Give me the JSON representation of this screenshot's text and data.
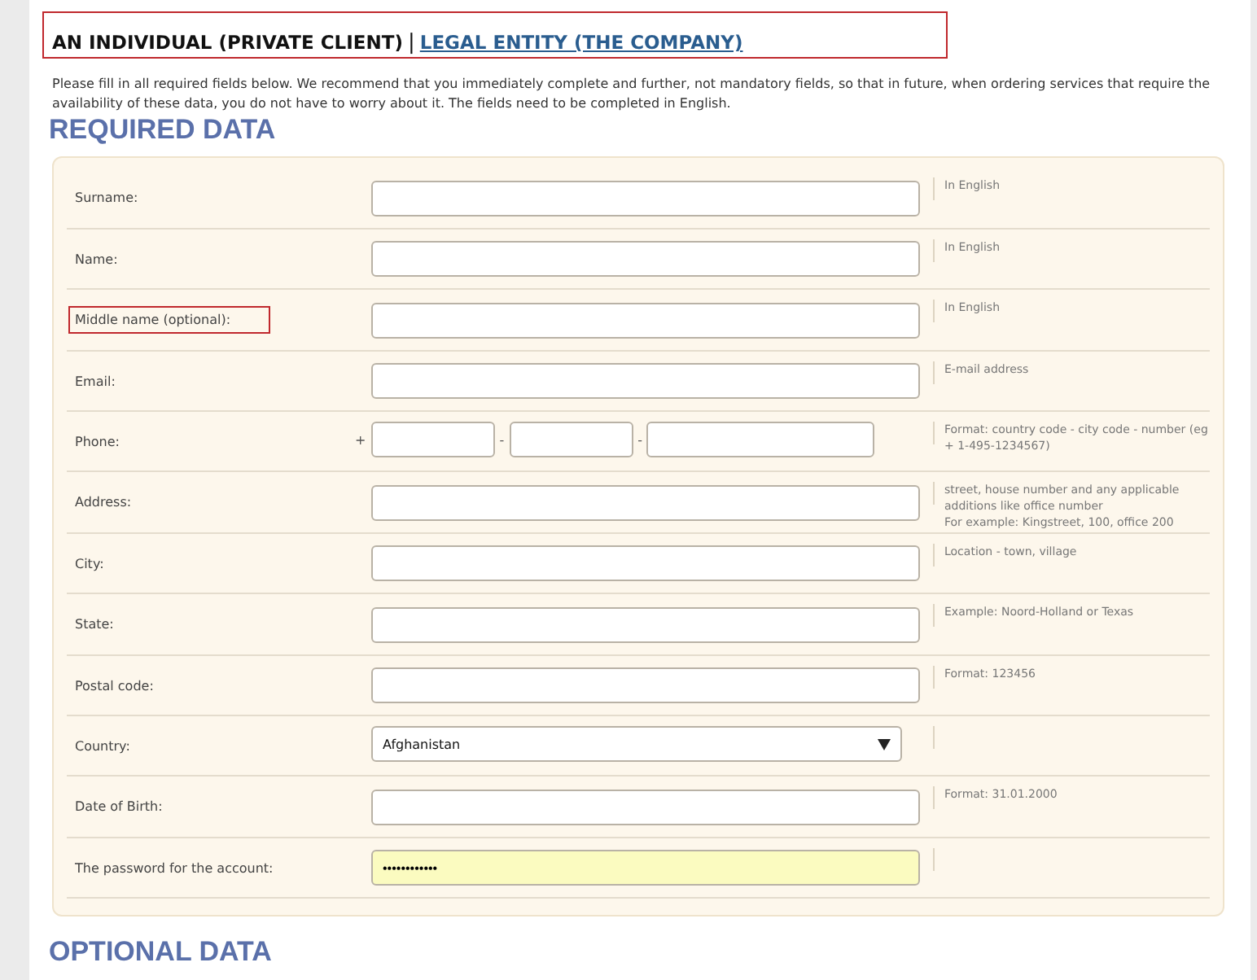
{
  "tabs": [
    {
      "label": "AN INDIVIDUAL (PRIVATE CLIENT)",
      "selected": true
    },
    {
      "label": "LEGAL ENTITY (THE COMPANY)",
      "selected": false
    }
  ],
  "tabs_highlighted": true,
  "separator": "|",
  "intro": "Please fill in all required fields below. We recommend that you immediately complete and further, not mandatory fields, so that in future, when ordering services that require the availability of these data, you do not have to worry about it. The fields need to be completed in English.",
  "required_heading": "REQUIRED DATA",
  "fields": [
    {
      "kind": "text",
      "label": "Surname:",
      "highlighted": false,
      "hint": "In English"
    },
    {
      "kind": "text",
      "label": "Name:",
      "highlighted": false,
      "hint": "In English"
    },
    {
      "kind": "text",
      "label": "Middle name (optional):",
      "highlighted": true,
      "hint": "In English"
    },
    {
      "kind": "text",
      "label": "Email:",
      "highlighted": false,
      "hint": "E-mail address"
    },
    {
      "kind": "phone",
      "label": "Phone:",
      "highlighted": false,
      "prefix": "+",
      "dash": "-",
      "hint": "Format: country code - city code - number (eg + 1-495-1234567)"
    },
    {
      "kind": "text",
      "label": "Address:",
      "highlighted": false,
      "hint": "street, house number and any applicable additions like office number\nFor example: Kingstreet, 100, office 200"
    },
    {
      "kind": "text",
      "label": "City:",
      "highlighted": false,
      "hint": "Location - town, village"
    },
    {
      "kind": "text",
      "label": "State:",
      "highlighted": false,
      "hint": "Example: Noord-Holland or Texas"
    },
    {
      "kind": "text",
      "label": "Postal code:",
      "highlighted": false,
      "hint": "Format: 123456"
    },
    {
      "kind": "select",
      "label": "Country:",
      "highlighted": false,
      "value": "Afghanistan"
    },
    {
      "kind": "text",
      "label": "Date of Birth:",
      "highlighted": false,
      "hint": "Format: 31.01.2000"
    },
    {
      "kind": "password",
      "label": "The password for the account:",
      "highlighted": false,
      "value": "••••••••••••"
    }
  ],
  "optional_heading": "OPTIONAL DATA"
}
